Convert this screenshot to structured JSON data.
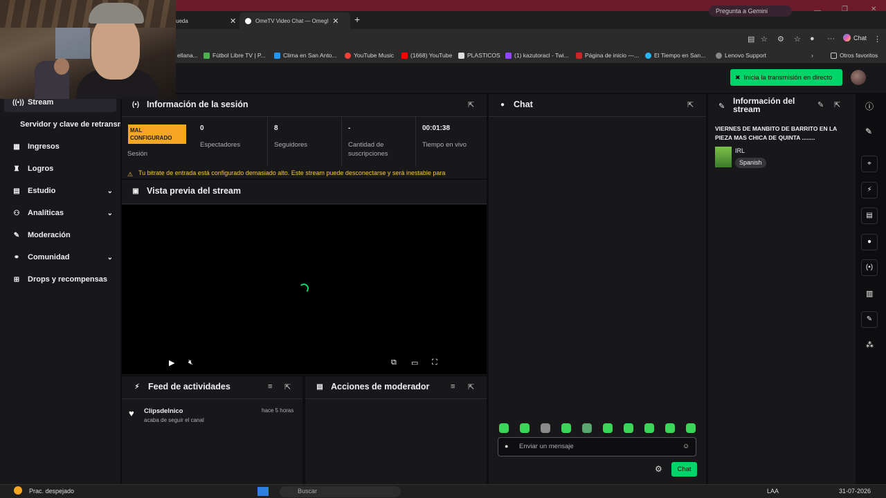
{
  "browser": {
    "tabs": [
      {
        "label": "ueda",
        "active": false
      },
      {
        "label": "OmeTV Video Chat — Omegl",
        "active": true
      }
    ],
    "gemini_label": "Pregunta a Gemini",
    "chat_button": "Chat",
    "bookmarks": [
      "ellana...",
      "Fútbol Libre TV | P...",
      "Clima en San Anto...",
      "YouTube Music",
      "(1668) YouTube",
      "PLASTICOS",
      "(1) kazutoracl - Twi...",
      "Página de inicio —...",
      "El Tiempo en San...",
      "Lenovo Support"
    ],
    "other_bookmarks": "Otros favoritos"
  },
  "header": {
    "golive": "Inicia la transmisión en directo"
  },
  "nav": {
    "stream": "Stream",
    "server_key": "Servidor y clave de retransm",
    "items": [
      {
        "label": "Ingresos",
        "icon": "revenue-icon",
        "chevron": false
      },
      {
        "label": "Logros",
        "icon": "trophy-icon",
        "chevron": false
      },
      {
        "label": "Estudio",
        "icon": "studio-icon",
        "chevron": true
      },
      {
        "label": "Analíticas",
        "icon": "analytics-icon",
        "chevron": true
      },
      {
        "label": "Moderación",
        "icon": "wrench-icon",
        "chevron": false
      },
      {
        "label": "Comunidad",
        "icon": "community-icon",
        "chevron": true
      },
      {
        "label": "Drops y recompensas",
        "icon": "drops-icon",
        "chevron": false
      }
    ]
  },
  "session": {
    "title": "Información de la sesión",
    "badge": "MAL CONFIGURADO",
    "badge_label": "Sesión",
    "stats": [
      {
        "value": "0",
        "label": "Espectadores"
      },
      {
        "value": "8",
        "label": "Seguidores"
      },
      {
        "value": "-",
        "label": "Cantidad de suscripciones"
      },
      {
        "value": "00:01:38",
        "label": "Tiempo en vivo"
      }
    ],
    "warning": "Tu bitrate de entrada está configurado demasiado alto. Este stream puede desconectarse y será inestable para"
  },
  "preview": {
    "title": "Vista previa del stream"
  },
  "activity": {
    "title": "Feed de actividades",
    "items": [
      {
        "user": "Clipsdelnico",
        "action": "acaba de seguir el canal",
        "time": "hace 5 horas"
      }
    ]
  },
  "modactions": {
    "title": "Acciones de moderador"
  },
  "chat": {
    "title": "Chat",
    "placeholder": "Enviar un mensaje",
    "send": "Chat"
  },
  "streaminfo": {
    "title": "Información del stream",
    "stream_title": "VIERNES DE MANBITO DE BARRITO EN LA PIEZA MAS CHICA DE QUINTA ........",
    "category": "IRL",
    "tag": "Spanish"
  },
  "taskbar": {
    "weather": "Prac. despejado",
    "search": "Buscar",
    "lang": "LAA",
    "date": "31-07-2026"
  },
  "colors": {
    "accent": "#00d56a",
    "warning_badge": "#f5a623",
    "warning_text": "#f5c646"
  }
}
